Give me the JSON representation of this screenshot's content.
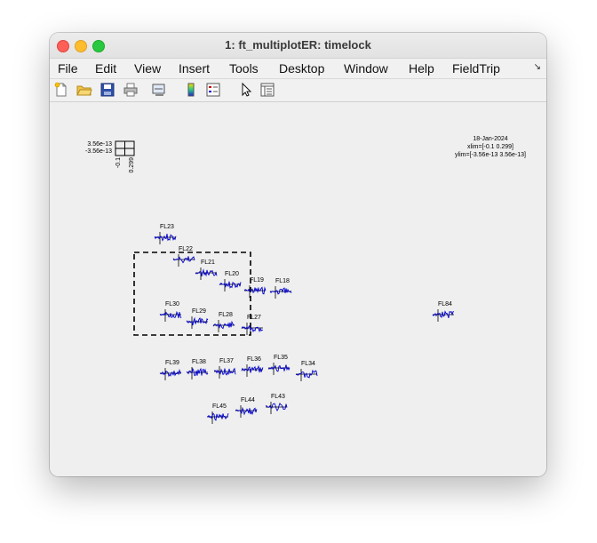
{
  "window": {
    "title": "1: ft_multiplotER: timelock"
  },
  "menu": {
    "items": [
      "File",
      "Edit",
      "View",
      "Insert",
      "Tools",
      "Desktop",
      "Window",
      "Help",
      "FieldTrip"
    ]
  },
  "toolbar": {
    "buttons": [
      "new-figure-icon",
      "open-file-icon",
      "save-icon",
      "print-icon",
      "link-icon",
      "colorbar-icon",
      "legend-icon",
      "pointer-icon",
      "property-inspector-icon"
    ]
  },
  "plot": {
    "scale": {
      "ymax": "3.56e-13",
      "ymin": "-3.56e-13",
      "xmin": "-0.1",
      "xmax": "0.299"
    },
    "info": {
      "date": "18-Jan-2024",
      "xlim": "xlim=[-0.1 0.299]",
      "ylim": "ylim=[-3.56e-13 3.56e-13]"
    },
    "trace_color": "#0000cc",
    "channels": [
      "FL23",
      "FL22",
      "FL21",
      "FL20",
      "FL19",
      "FL18",
      "FL30",
      "FL29",
      "FL28",
      "FL27",
      "FL84",
      "FL39",
      "FL38",
      "FL37",
      "FL36",
      "FL35",
      "FL34",
      "FL45",
      "FL44",
      "FL43"
    ]
  }
}
